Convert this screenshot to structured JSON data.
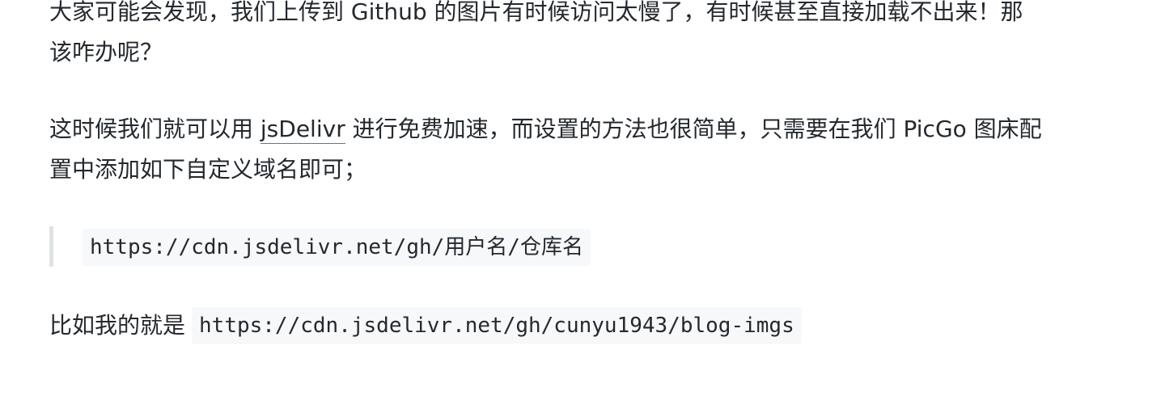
{
  "article": {
    "p1": {
      "line1": "大家可能会发现，我们上传到 Github 的图片有时候访问太慢了，有时候甚至直接加载不出来！那",
      "line2": "该咋办呢？"
    },
    "p2": {
      "before_link": "这时候我们就可以用 ",
      "link": "jsDelivr",
      "after_link": " 进行免费加速，而设置的方法也很简单，只需要在我们 PicGo 图床配",
      "line2": "置中添加如下自定义域名即可；"
    },
    "blockquote": {
      "code": "https://cdn.jsdelivr.net/gh/用户名/仓库名"
    },
    "p4": {
      "text": "比如我的就是",
      "code": "https://cdn.jsdelivr.net/gh/cunyu1943/blog-imgs"
    }
  }
}
